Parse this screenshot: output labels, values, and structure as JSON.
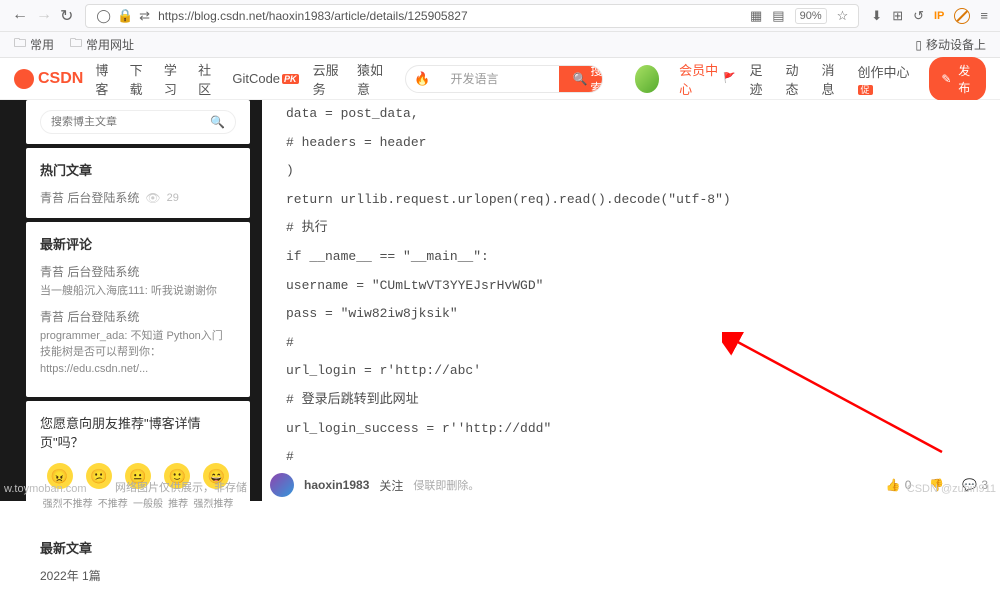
{
  "browser": {
    "url": "https://blog.csdn.net/haoxin1983/article/details/125905827",
    "zoom": "90%"
  },
  "bookmarks": {
    "freq": "常用",
    "freq_sites": "常用网址",
    "mobile": "移动设备上"
  },
  "header": {
    "logo": "CSDN",
    "nav": [
      "博客",
      "下载",
      "学习",
      "社区"
    ],
    "gitcode": "GitCode",
    "cloud": "云服务",
    "inkstone": "猿如意",
    "search_placeholder": "开发语言",
    "search_btn": "搜索",
    "vip": "会员中心",
    "footprint": "足迹",
    "dynamic": "动态",
    "messages": "消息",
    "creative": "创作中心",
    "publish": "发布"
  },
  "sidebar": {
    "search_placeholder": "搜索博主文章",
    "hot_title": "热门文章",
    "hot_items": [
      {
        "title": "青苔 后台登陆系统",
        "views": "29"
      }
    ],
    "comments_title": "最新评论",
    "comments": [
      {
        "post": "青苔 后台登陆系统",
        "author": "当一艘船沉入海底111:",
        "text": "听我说谢谢你"
      },
      {
        "post": "青苔 后台登陆系统",
        "author": "programmer_ada:",
        "text": "不知道 Python入门 技能树是否可以帮到你：https://edu.csdn.net/..."
      }
    ],
    "recommend_title": "您愿意向朋友推荐\"博客详情页\"吗？",
    "emoji_labels": [
      "强烈不推荐",
      "不推荐",
      "一般般",
      "推荐",
      "强烈推荐"
    ],
    "latest_title": "最新文章",
    "year_entry": "2022年  1篇"
  },
  "article": {
    "lines": [
      "data = post_data,",
      "# headers = header",
      ")",
      "return urllib.request.urlopen(req).read().decode(\"utf-8\")",
      "# 执行",
      "if __name__ == \"__main__\":",
      "username = \"CUmLtwVT3YYEJsrHvWGD\"",
      "pass = \"wiw82iw8jksik\"",
      "#",
      "url_login = r'http://abc'",
      "# 登录后跳转到此网址",
      "url_login_success = r''http://ddd\"",
      "#"
    ]
  },
  "bottom": {
    "author": "haoxin1983",
    "follow": "关注",
    "like": "0",
    "comment": "3",
    "source": "CSDN"
  },
  "watermarks": {
    "left": "w.toymoban.com",
    "disclaimer": "网络图片仅供展示，非存储",
    "right_del": "侵联即删除。",
    "right": "CSDN @zubin911"
  }
}
